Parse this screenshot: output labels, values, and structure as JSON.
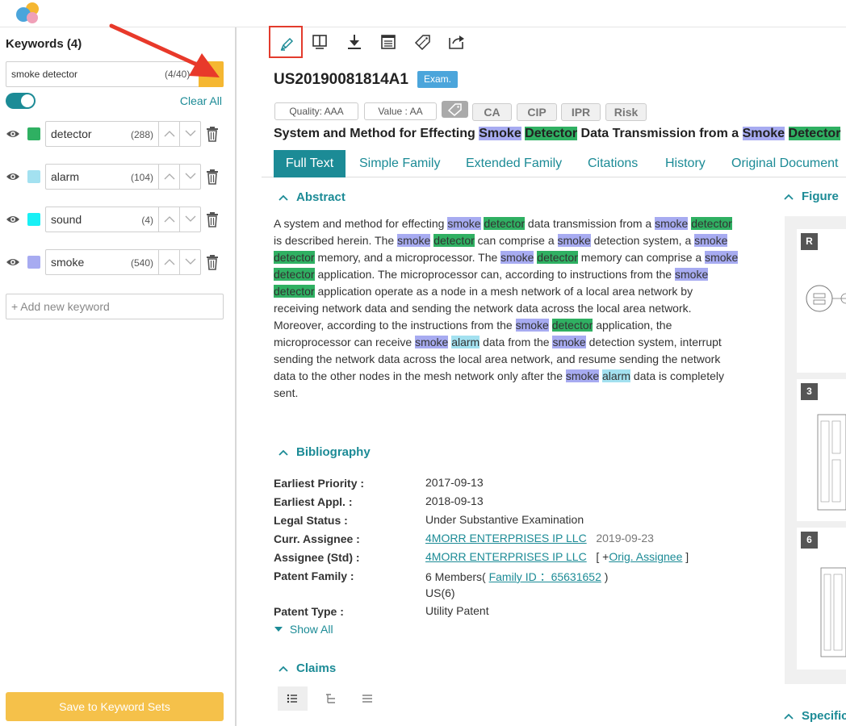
{
  "left": {
    "title": "Keywords (4)",
    "search": {
      "value": "smoke detector",
      "count": "(4/40)"
    },
    "clear_all": "Clear All",
    "keywords": [
      {
        "label": "detector",
        "count": "(288)",
        "color": "#2fb062"
      },
      {
        "label": "alarm",
        "count": "(104)",
        "color": "#a3e1f0"
      },
      {
        "label": "sound",
        "count": "(4)",
        "color": "#19f0f5"
      },
      {
        "label": "smoke",
        "count": "(540)",
        "color": "#a7abf1"
      }
    ],
    "add_placeholder": "+ Add new keyword",
    "save_label": "Save to Keyword Sets"
  },
  "toolbar": {
    "icons": [
      "highlight-icon",
      "split-view-icon",
      "download-icon",
      "document-icon",
      "tag-icon",
      "share-icon"
    ]
  },
  "patent": {
    "number": "US20190081814A1",
    "status_badge": "Exam.",
    "quality": "Quality: AAA",
    "value": "Value : AA",
    "chips": [
      "CA",
      "CIP",
      "IPR",
      "Risk"
    ],
    "title": {
      "t1": "System and Method for Effecting ",
      "smoke": "Smoke",
      "detector": "Detector",
      "t2": " Data Transmission from a "
    }
  },
  "tabs": [
    "Full Text",
    "Simple Family",
    "Extended Family",
    "Citations",
    "History",
    "Original Document"
  ],
  "sections": {
    "abstract": "Abstract",
    "figure": "Figure",
    "bibliography": "Bibliography",
    "claims": "Claims",
    "specific": "Specific"
  },
  "abstract": {
    "a": "A system and method for effecting ",
    "b": " data transmission from a ",
    "c": " is described herein. The ",
    "d": " can comprise a ",
    "e": " detection system, a ",
    "f": " memory, and a microprocessor. The ",
    "g": " memory can comprise a ",
    "h": " application. The microprocessor can, according to instructions from the ",
    "i": " application operate as a node in a mesh network of a local area network by receiving network data and sending the network data across the local area network. Moreover, according to the instructions from the ",
    "j": " application, the microprocessor can receive ",
    "k": " data from the ",
    "l": " detection system, interrupt sending the network data across the local area network, and resume sending the network data to the other nodes in the mesh network only after the ",
    "m": " data is completely sent.",
    "smoke": "smoke",
    "detector": "detector",
    "alarm": "alarm"
  },
  "bibliography": {
    "earliest_priority": {
      "label": "Earliest Priority :",
      "value": "2017-09-13"
    },
    "earliest_appl": {
      "label": "Earliest Appl. :",
      "value": "2018-09-13"
    },
    "legal_status": {
      "label": "Legal Status :",
      "value": "Under Substantive Examination"
    },
    "curr_assignee": {
      "label": "Curr. Assignee :",
      "value": "4MORR ENTERPRISES IP LLC",
      "date": "2019-09-23"
    },
    "assignee_std": {
      "label": "Assignee (Std) :",
      "value": "4MORR ENTERPRISES IP LLC",
      "pre": "[ +",
      "orig": "Orig. Assignee",
      "post": " ]"
    },
    "patent_family": {
      "label": "Patent Family :",
      "pre": "6 Members(",
      "link": "Family ID ：65631652",
      "post": " )",
      "line2": "US(6)"
    },
    "patent_type": {
      "label": "Patent Type :",
      "value": "Utility Patent"
    },
    "show_all": "Show All"
  },
  "figures": [
    "R",
    "3",
    "6"
  ]
}
